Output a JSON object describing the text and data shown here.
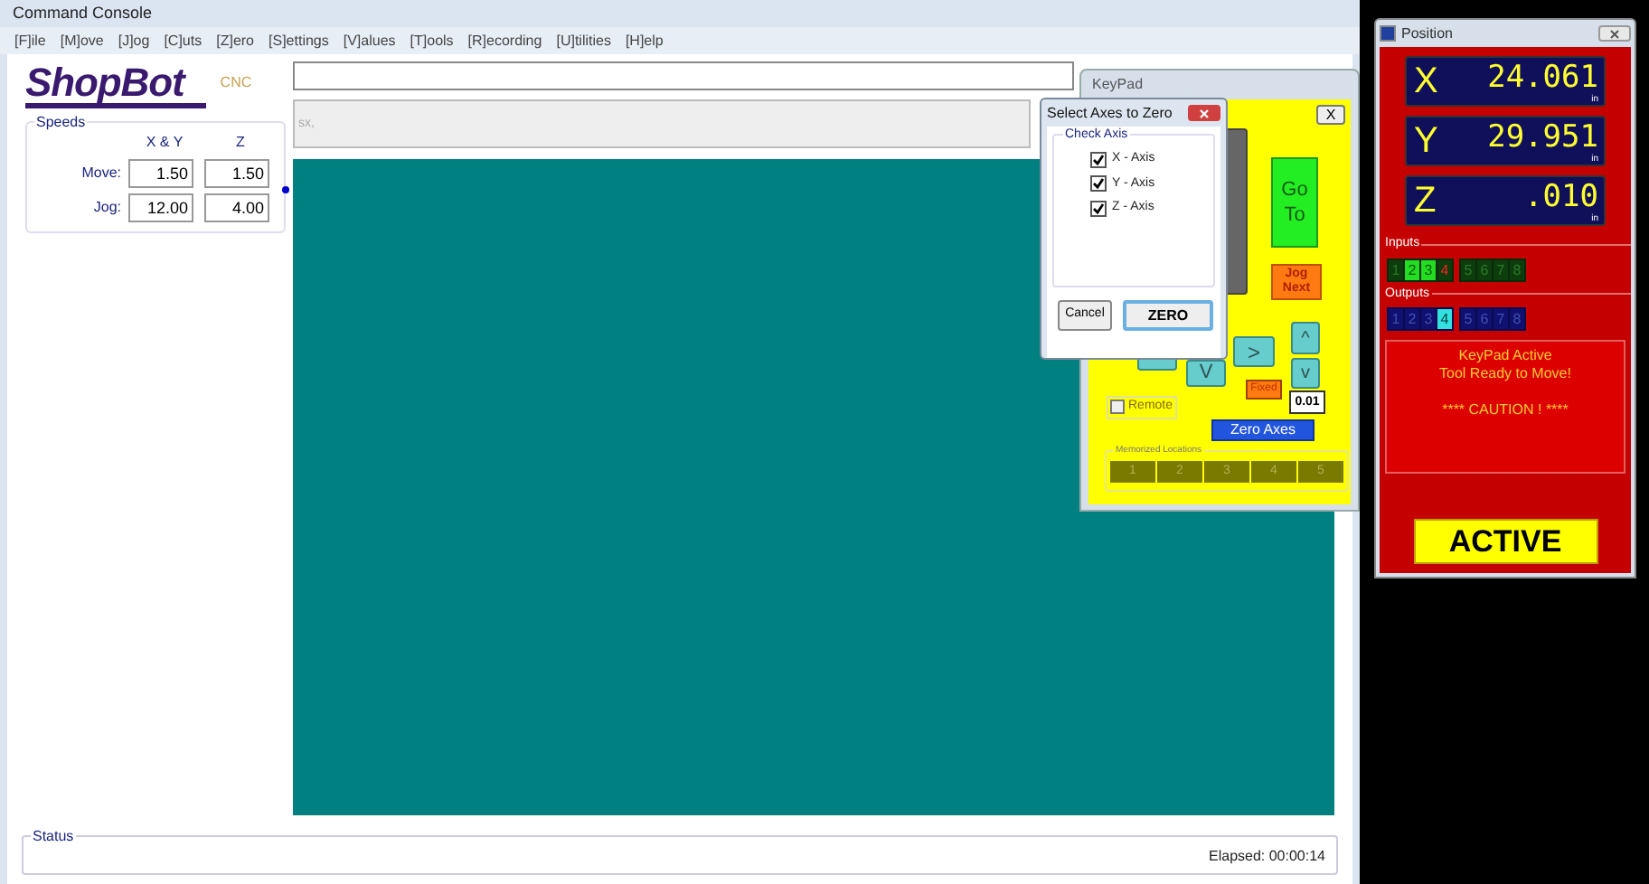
{
  "main_window": {
    "title": "Command Console",
    "menu": [
      "[F]ile",
      "[M]ove",
      "[J]og",
      "[C]uts",
      "[Z]ero",
      "[S]ettings",
      "[V]alues",
      "[T]ools",
      "[R]ecording",
      "[U]tilities",
      "[H]elp"
    ],
    "logo": {
      "name": "ShopBot",
      "suffix": "CNC"
    },
    "prompt_field": {
      "placeholder": "sx,"
    },
    "speeds": {
      "title": "Speeds",
      "columns": [
        "X & Y",
        "Z"
      ],
      "rows": [
        {
          "label": "Move:",
          "values": [
            "1.50",
            "1.50"
          ]
        },
        {
          "label": "Jog:",
          "values": [
            "12.00",
            "4.00"
          ]
        }
      ]
    },
    "status": {
      "title": "Status",
      "elapsed": "Elapsed: 00:00:14"
    }
  },
  "keypad": {
    "title": "KeyPad",
    "close": "X",
    "go": "Go To",
    "jog_next": "Jog Next",
    "up": "^",
    "down": "v",
    "right": ">",
    "down_large": "V",
    "fixed": "Fixed",
    "step": "0.01",
    "remote": {
      "label": "Remote",
      "checked": false
    },
    "zero_axes": "Zero Axes",
    "memorized": {
      "title": "Memorized Locations",
      "slots": [
        "1",
        "2",
        "3",
        "4",
        "5"
      ]
    }
  },
  "dialog": {
    "title": "Select Axes to Zero",
    "group": "Check Axis",
    "axes": [
      {
        "label": "X - Axis",
        "checked": true
      },
      {
        "label": "Y - Axis",
        "checked": true
      },
      {
        "label": "Z - Axis",
        "checked": true
      }
    ],
    "cancel": "Cancel",
    "zero": "ZERO"
  },
  "position": {
    "title": "Position",
    "axes": [
      {
        "label": "X",
        "value": "24.061",
        "unit": "in"
      },
      {
        "label": "Y",
        "value": "29.951",
        "unit": "in"
      },
      {
        "label": "Z",
        "value": ".010",
        "unit": "in"
      }
    ],
    "inputs": {
      "title": "Inputs",
      "pins": [
        {
          "label": "1",
          "on": false,
          "alert": false
        },
        {
          "label": "2",
          "on": true,
          "alert": false
        },
        {
          "label": "3",
          "on": true,
          "alert": false
        },
        {
          "label": "4",
          "on": false,
          "alert": true
        },
        {
          "label": "5",
          "on": false,
          "alert": false
        },
        {
          "label": "6",
          "on": false,
          "alert": false
        },
        {
          "label": "7",
          "on": false,
          "alert": false
        },
        {
          "label": "8",
          "on": false,
          "alert": false
        }
      ]
    },
    "outputs": {
      "title": "Outputs",
      "pins": [
        {
          "label": "1",
          "on": false
        },
        {
          "label": "2",
          "on": false
        },
        {
          "label": "3",
          "on": false
        },
        {
          "label": "4",
          "on": true
        },
        {
          "label": "5",
          "on": false
        },
        {
          "label": "6",
          "on": false
        },
        {
          "label": "7",
          "on": false
        },
        {
          "label": "8",
          "on": false
        }
      ]
    },
    "message": [
      "KeyPad Active",
      "Tool Ready to Move!",
      "**** CAUTION ! ****"
    ],
    "status": "ACTIVE"
  }
}
